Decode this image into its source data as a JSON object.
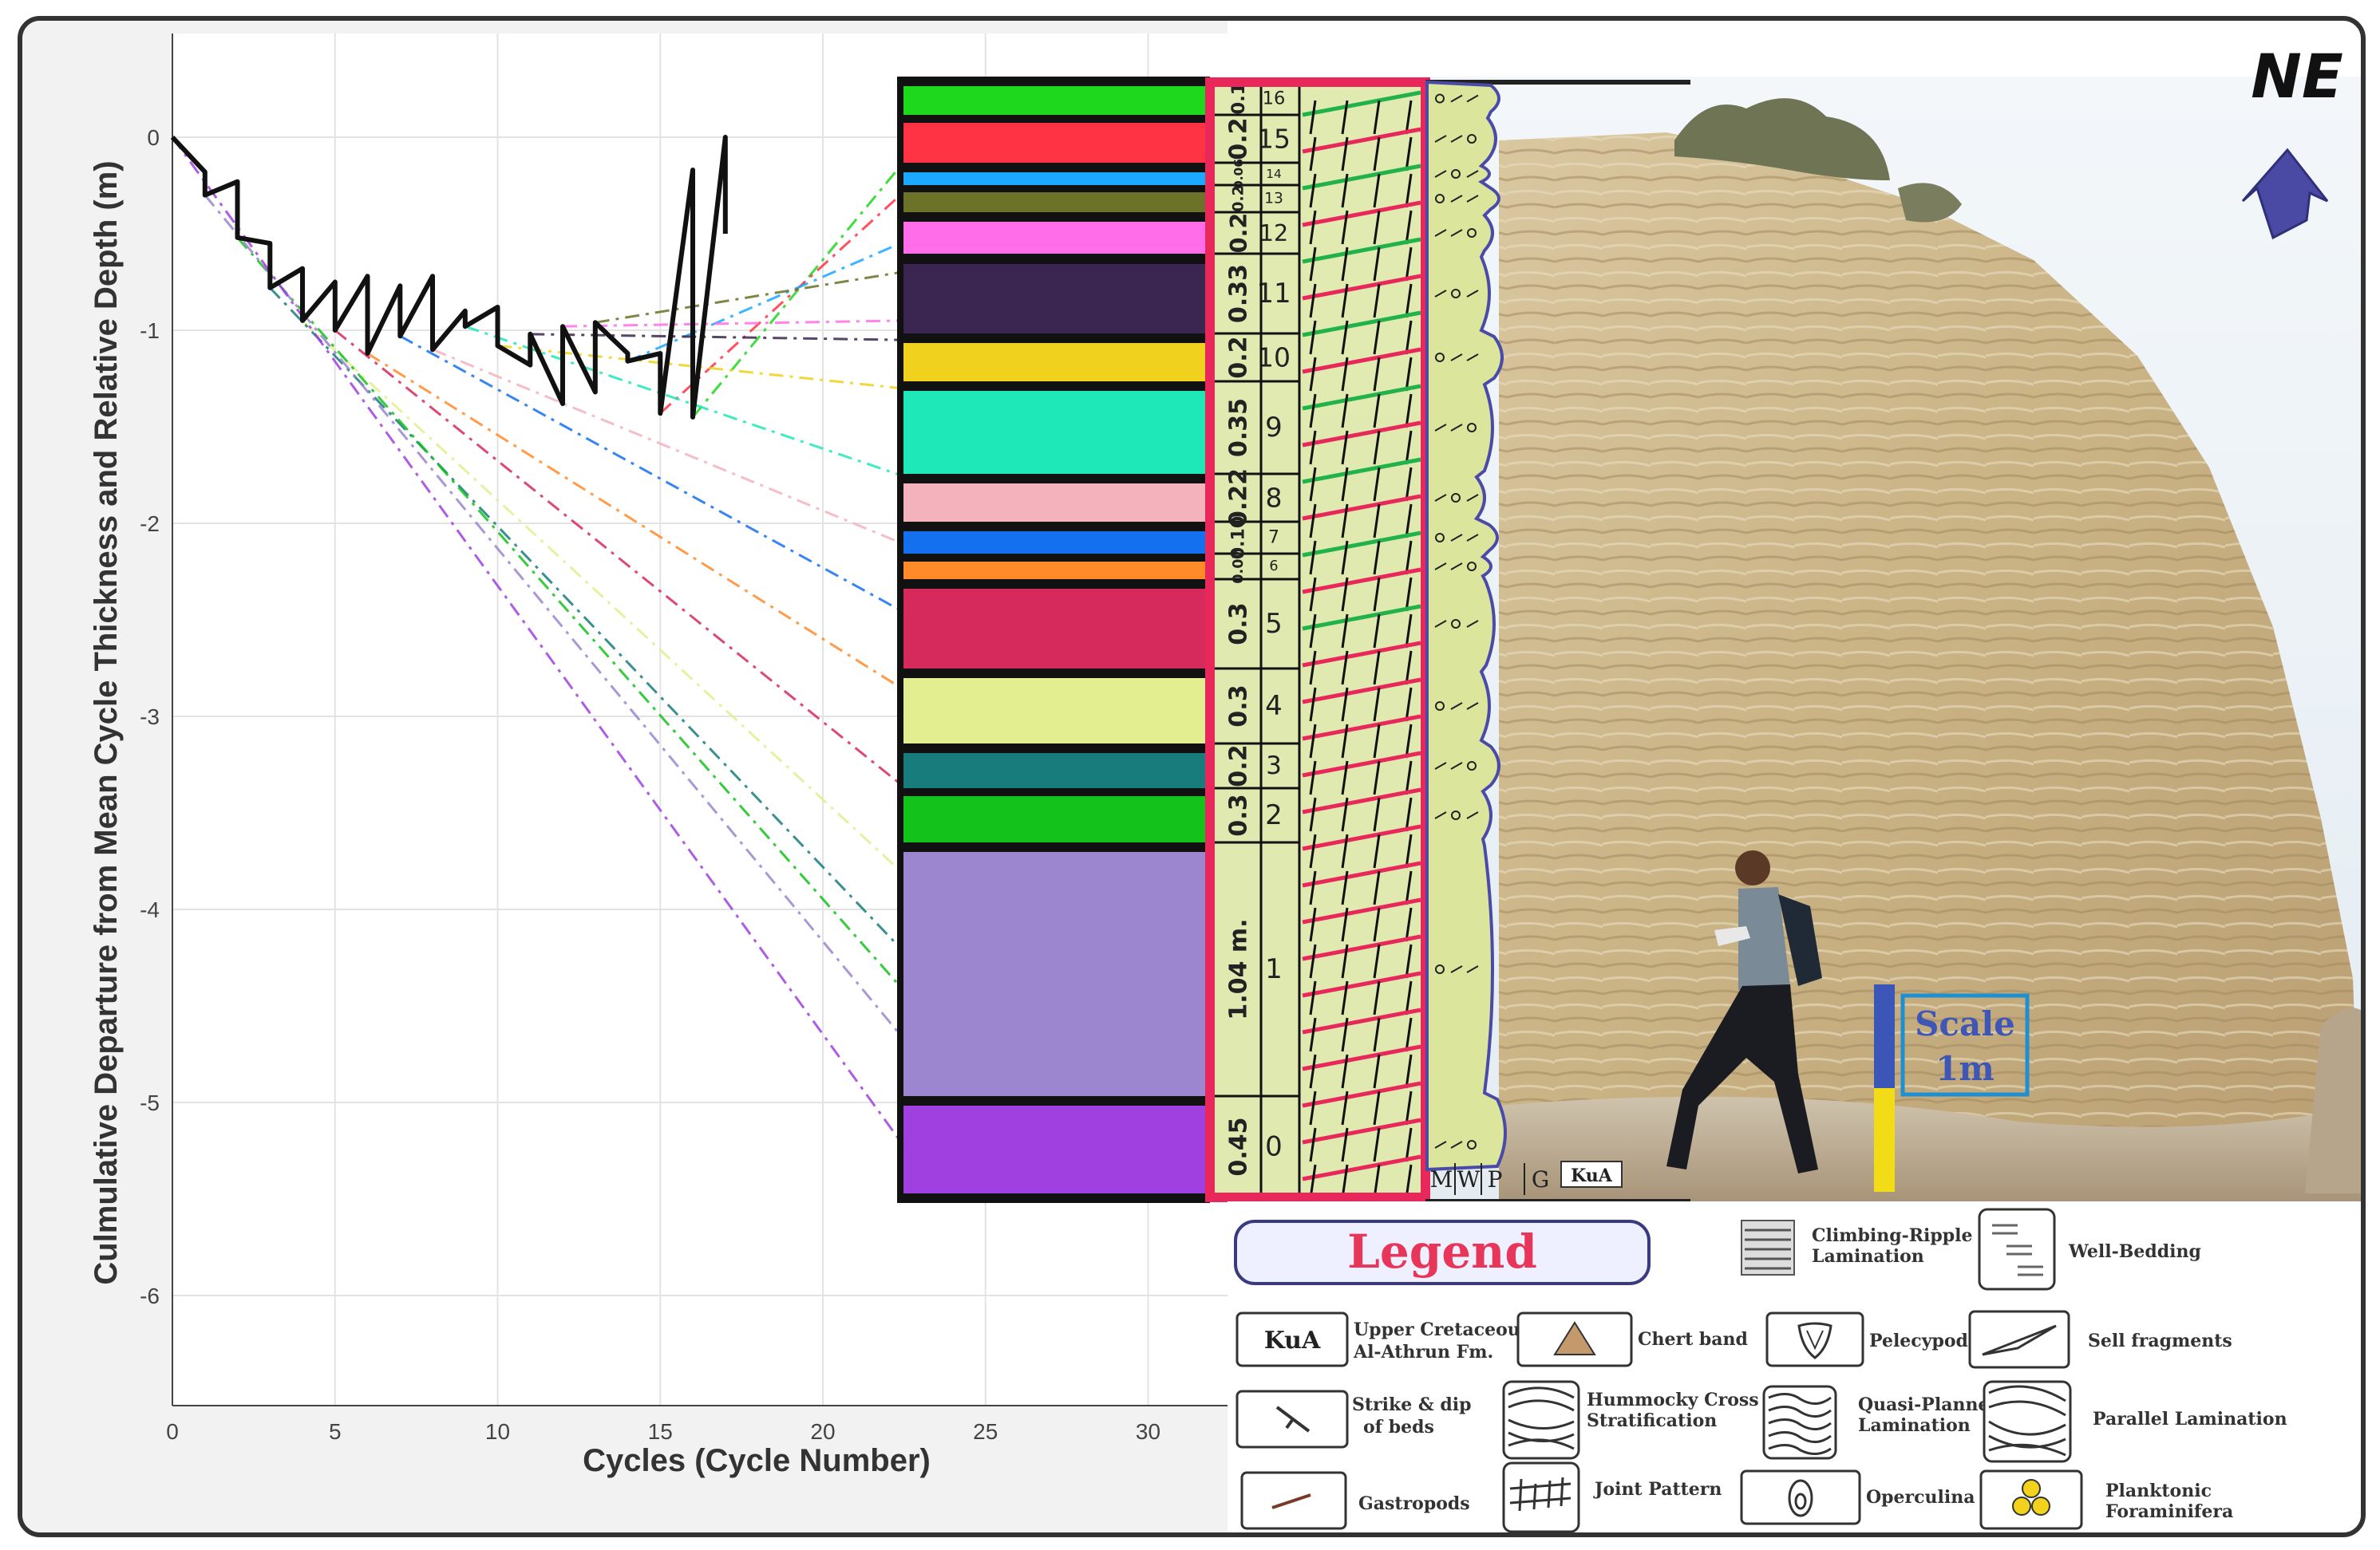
{
  "plot": {
    "ylabel": "Culmulative Departure from Mean Cycle Thickness and Relative Depth (m)",
    "xlabel": "Cycles (Cycle Number)",
    "x_ticks": [
      "0",
      "5",
      "10",
      "15",
      "20",
      "25",
      "30"
    ],
    "y_ticks": [
      "0",
      "-1",
      "-2",
      "-3",
      "-4",
      "-5",
      "-6"
    ]
  },
  "chart_data": {
    "type": "line",
    "title": "",
    "xlabel": "Cycles (Cycle Number)",
    "ylabel": "Culmulative Departure from Mean Cycle Thickness and Relative Depth (m)",
    "xlim": [
      0,
      32
    ],
    "ylim": [
      -6.6,
      0.3
    ],
    "grid": true,
    "fischer_curve": {
      "x": [
        0,
        1,
        1,
        2,
        2,
        3,
        3,
        4,
        4,
        5,
        5,
        6,
        6,
        7,
        7,
        8,
        8,
        9,
        9,
        10,
        10,
        11,
        11,
        12,
        12,
        13,
        13,
        14,
        14,
        15,
        15,
        16,
        16,
        17,
        17
      ],
      "y": [
        0,
        -0.18,
        -0.3,
        -0.23,
        -0.52,
        -0.55,
        -0.78,
        -0.68,
        -0.95,
        -0.75,
        -1.0,
        -0.72,
        -1.12,
        -0.77,
        -1.03,
        -0.72,
        -1.1,
        -0.9,
        -0.98,
        -0.88,
        -1.08,
        -1.18,
        -1.02,
        -1.38,
        -0.98,
        -1.32,
        -0.96,
        -1.12,
        -1.16,
        -1.12,
        -1.43,
        -0.17,
        -1.45,
        0,
        -0.5
      ]
    },
    "cycle_numbers": [
      "16",
      "15",
      "14",
      "13",
      "12",
      "11",
      "10",
      "9",
      "8",
      "7",
      "6",
      "5",
      "4",
      "3",
      "2",
      "1",
      "0"
    ],
    "cycle_thicknesses": [
      "0.1",
      "0.2",
      "0.06",
      "0.2",
      "0.2",
      "0.33",
      "0.2",
      "0.35",
      "0.22",
      "0.10",
      "0.07",
      "0.3",
      "0.3",
      "0.2",
      "0.3",
      "1.04 m.",
      "0.45"
    ],
    "cycle_colors": [
      "#1ed81e",
      "#ff3344",
      "#1aa9ff",
      "#6c7228",
      "#ff6ee8",
      "#3a2650",
      "#f0d21e",
      "#1ee8b8",
      "#f4b2bc",
      "#1570f0",
      "#ff8a2a",
      "#d62a5c",
      "#e2ee90",
      "#187c7c",
      "#13c21b",
      "#9c86cf",
      "#a040e0"
    ],
    "cycle_bed_depths": [
      -5.2,
      -4.65,
      -4.4,
      -4.2,
      -3.8,
      -3.35,
      -2.85,
      -2.45,
      -2.1,
      -1.75,
      -1.3,
      -1.05,
      -0.95,
      -0.7,
      -0.55,
      -0.3,
      -0.15
    ]
  },
  "lithology": {
    "column_headers": [
      "M",
      "W",
      "P",
      "G"
    ],
    "base_unit": "KuA"
  },
  "photo": {
    "north_label": "NE",
    "scale_label_1": "Scale",
    "scale_label_2": "1m"
  },
  "legend": {
    "title": "Legend",
    "items": {
      "kua_symbol": "KuA",
      "kua_label_1": "Upper Cretaceous",
      "kua_label_2": "Al-Athrun Fm.",
      "chert": "Chert band",
      "pelecypoda": "Pelecypoda",
      "shell": "Sell fragments",
      "climbing_1": "Climbing-Ripple",
      "climbing_2": "Lamination",
      "well_bedding": "Well-Bedding",
      "strike_1": "Strike & dip",
      "strike_2": "of beds",
      "hummocky_1": "Hummocky Cross",
      "hummocky_2": "Stratification",
      "quasi_1": "Quasi-Planner",
      "quasi_2": "Lamination",
      "parallel": "Parallel Lamination",
      "gastropods": "Gastropods",
      "joint": "Joint Pattern",
      "operculina": "Operculina",
      "plankt_1": "Planktonic",
      "plankt_2": "Foraminifera"
    },
    "colors": {
      "title": "#e8365a",
      "box_border": "#3a3a80",
      "box_fill": "#eef0ff"
    }
  }
}
